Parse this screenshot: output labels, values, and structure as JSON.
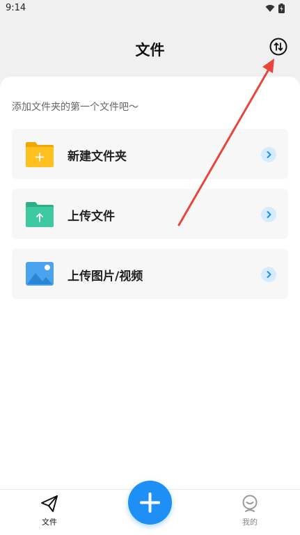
{
  "status_bar": {
    "time": "9:14",
    "icons": [
      "wifi-icon",
      "battery-icon"
    ]
  },
  "header": {
    "title": "文件",
    "sort_icon": "sort-arrows-icon"
  },
  "main": {
    "hint": "添加文件夹的第一个文件吧～",
    "actions": [
      {
        "label": "新建文件夹",
        "icon": "new-folder-icon",
        "color": "#ffc020"
      },
      {
        "label": "上传文件",
        "icon": "upload-file-icon",
        "color": "#3ec9a0"
      },
      {
        "label": "上传图片/视频",
        "icon": "upload-image-icon",
        "color": "#4aa3ef"
      }
    ]
  },
  "bottom_nav": {
    "items": [
      {
        "label": "文件",
        "icon": "paper-plane-icon",
        "active": true
      },
      {
        "label": "我的",
        "icon": "profile-icon",
        "active": false
      }
    ],
    "fab_icon": "plus-icon"
  },
  "colors": {
    "accent": "#1d8ff5",
    "annotation": "#e8453c",
    "chevron_bg": "#d6ecfd",
    "chevron_fg": "#1d8ff5"
  }
}
